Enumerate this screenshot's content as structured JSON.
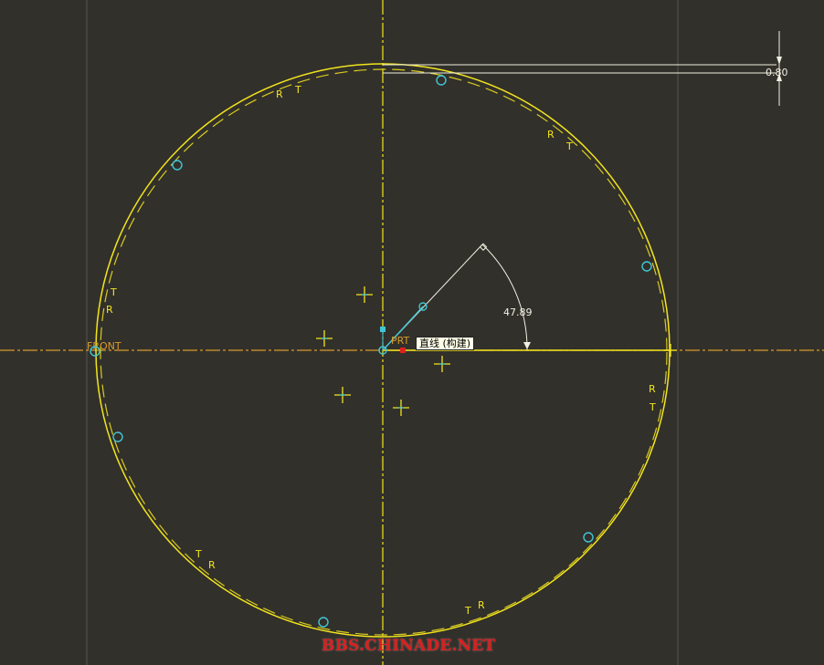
{
  "colors": {
    "background": "#32302b",
    "sketch_yellow": "#f2e51d",
    "sketch_yellow_dim": "#d8cc20",
    "datum_orange": "#d89a2a",
    "point_cyan": "#3fc7d6",
    "selection_red": "#e02020",
    "dimension_white": "#f0f0e0",
    "grid_line": "#55534c"
  },
  "datum_labels": {
    "front": "FRONT",
    "prt": "PRT"
  },
  "dimensions": {
    "angle": "47.89",
    "offset": "0.80"
  },
  "constraint_labels": {
    "r": "R",
    "t": "T"
  },
  "tooltip": {
    "text": "直线 (构建)"
  },
  "icons": {
    "circle_point": "circle-point-icon",
    "cross_point": "cross-point-icon",
    "arrowhead": "arrowhead-icon"
  },
  "watermark": {
    "text": "BBS.CHINADE.NET"
  }
}
